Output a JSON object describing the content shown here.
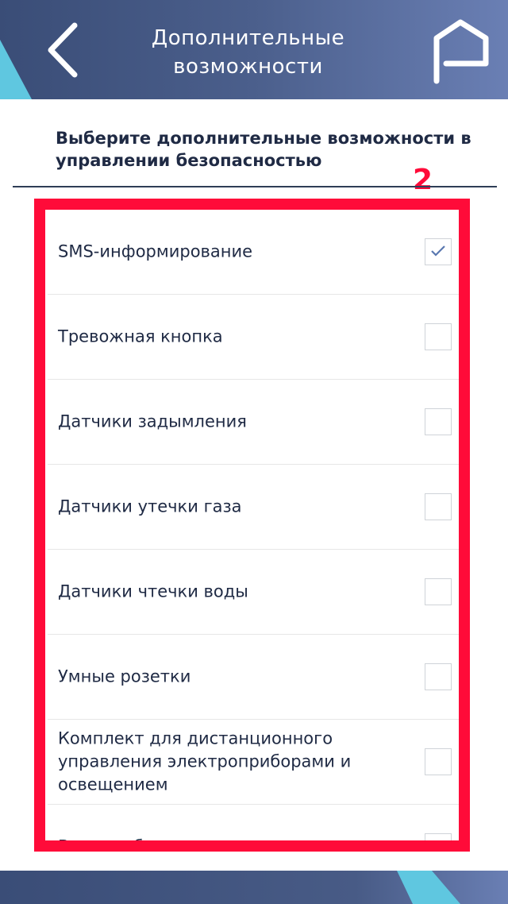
{
  "header": {
    "title": "Дополнительные возможности",
    "back_icon": "chevron-left-icon",
    "home_icon": "home-icon"
  },
  "subtitle": "Выберите дополнительные возможности в управлении безопасностью",
  "step_number": "2",
  "options": [
    {
      "label": "SMS-информирование",
      "checked": true
    },
    {
      "label": "Тревожная кнопка",
      "checked": false
    },
    {
      "label": "Датчики задымления",
      "checked": false
    },
    {
      "label": "Датчики утечки газа",
      "checked": false
    },
    {
      "label": "Датчики чтечки воды",
      "checked": false
    },
    {
      "label": "Умные розетки",
      "checked": false
    },
    {
      "label": "Комплект для дистанционного управления электроприборами и освещением",
      "checked": false
    },
    {
      "label": "Видеонаблюдение",
      "checked": false
    }
  ],
  "colors": {
    "header_dark": "#3a4d77",
    "header_light": "#6a7fb4",
    "accent_cyan": "#5fc7e0",
    "highlight_red": "#ff0b39",
    "text_dark": "#1f2a44",
    "check_color": "#5a78b0"
  }
}
